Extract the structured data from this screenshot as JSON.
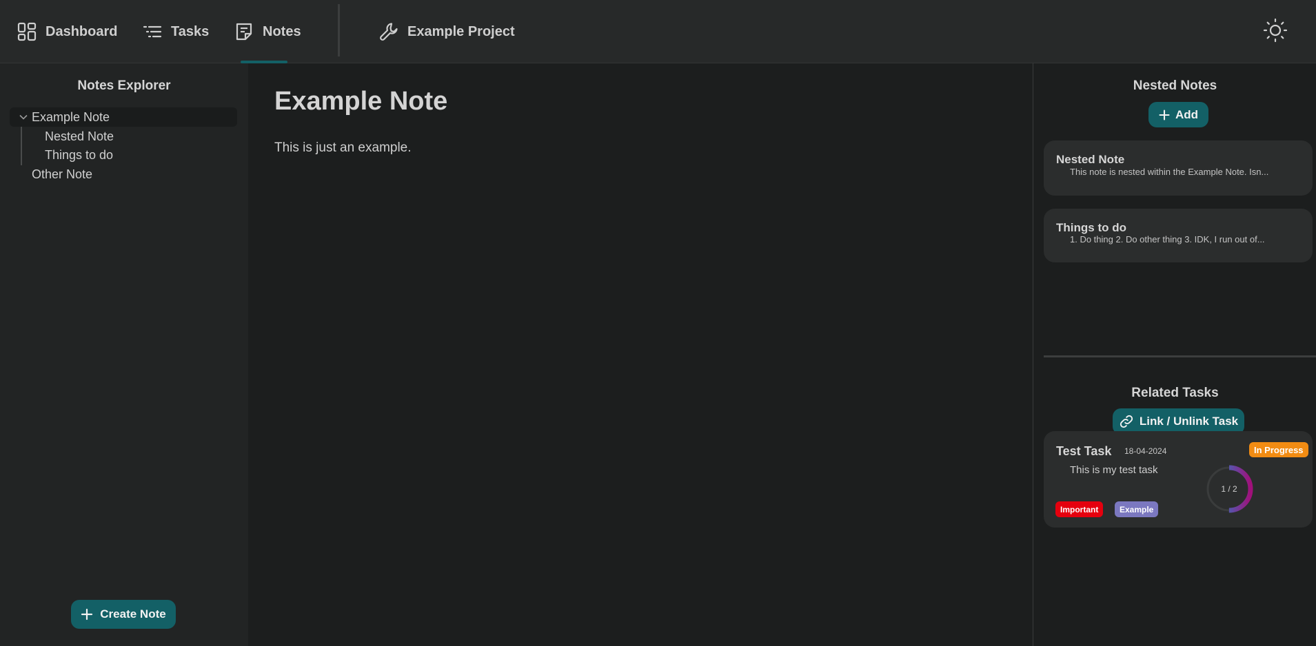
{
  "nav": {
    "items": [
      {
        "label": "Dashboard",
        "icon": "dashboard-icon"
      },
      {
        "label": "Tasks",
        "icon": "tasks-list-icon"
      },
      {
        "label": "Notes",
        "icon": "notes-icon",
        "active": true
      }
    ],
    "project": {
      "label": "Example Project",
      "icon": "wrench-icon"
    },
    "theme_icon": "sun-icon",
    "accent": "#136066"
  },
  "sidebar": {
    "title": "Notes Explorer",
    "tree": [
      {
        "label": "Example Note",
        "expanded": true,
        "selected": true
      },
      {
        "label": "Nested Note"
      },
      {
        "label": "Things to do"
      },
      {
        "label": "Other Note"
      }
    ],
    "create_button": "Create Note"
  },
  "editor": {
    "title": "Example Note",
    "body": "This is just an example."
  },
  "right": {
    "nested": {
      "title": "Nested Notes",
      "add_button": "Add",
      "cards": [
        {
          "title": "Nested Note",
          "preview": "This note is nested within the Example Note. Isn..."
        },
        {
          "title": "Things to do",
          "preview": "1. Do thing 2. Do other thing 3. IDK, I run out of..."
        }
      ]
    },
    "related": {
      "title": "Related Tasks",
      "link_button": "Link / Unlink Task",
      "task": {
        "title": "Test Task",
        "date": "18-04-2024",
        "status": "In Progress",
        "status_color": "#f28c13",
        "description": "This is my test task",
        "progress_text": "1 / 2",
        "progress": 0.5,
        "tags": [
          {
            "label": "Important",
            "color": "#e5000e"
          },
          {
            "label": "Example",
            "color": "#7b78c0"
          }
        ]
      }
    }
  }
}
